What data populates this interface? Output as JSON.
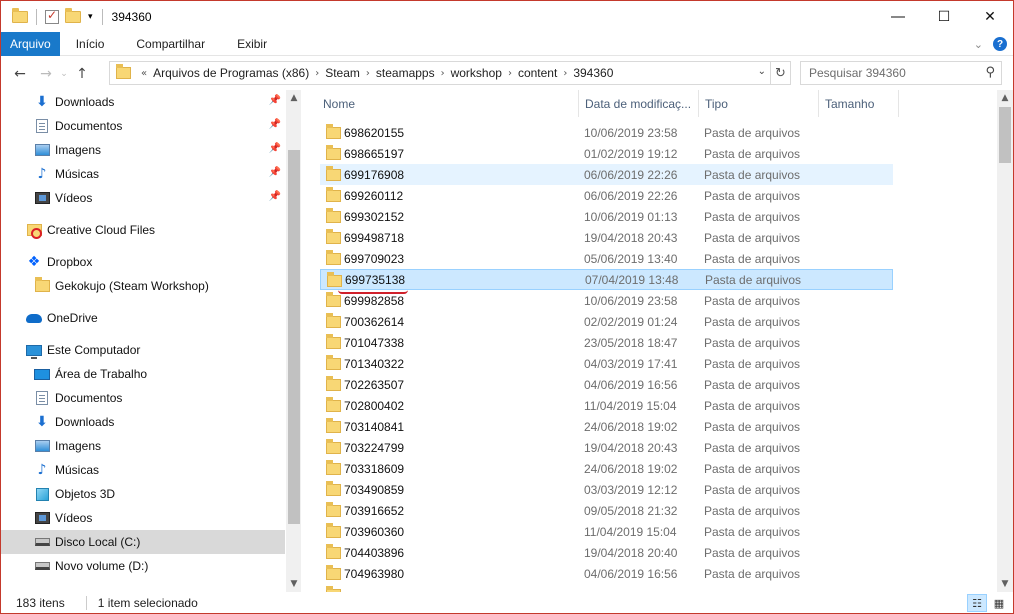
{
  "window": {
    "title": "394360"
  },
  "ribbon": {
    "tabs": [
      "Arquivo",
      "Início",
      "Compartilhar",
      "Exibir"
    ]
  },
  "nav_buttons": {
    "back": "←",
    "forward": "→",
    "recent": "⌄",
    "up": "↑",
    "refresh": "↻"
  },
  "address": {
    "lead": "«",
    "crumbs": [
      "Arquivos de Programas (x86)",
      "Steam",
      "steamapps",
      "workshop",
      "content",
      "394360"
    ]
  },
  "search": {
    "placeholder": "Pesquisar 394360"
  },
  "navpane": {
    "items": [
      {
        "label": "Downloads",
        "icon": "download-icon",
        "pinned": true
      },
      {
        "label": "Documentos",
        "icon": "document-icon",
        "pinned": true
      },
      {
        "label": "Imagens",
        "icon": "image-icon",
        "pinned": true
      },
      {
        "label": "Músicas",
        "icon": "music-icon",
        "pinned": true
      },
      {
        "label": "Vídeos",
        "icon": "video-icon",
        "pinned": true
      },
      {
        "label": "Creative Cloud Files",
        "icon": "creative-cloud-icon",
        "pinned": false
      },
      {
        "label": "Dropbox",
        "icon": "dropbox-icon",
        "pinned": false
      },
      {
        "label": "Gekokujo (Steam Workshop)",
        "icon": "folder-icon",
        "pinned": false
      },
      {
        "label": "OneDrive",
        "icon": "onedrive-icon",
        "pinned": false
      },
      {
        "label": "Este Computador",
        "icon": "computer-icon",
        "pinned": false
      },
      {
        "label": "Área de Trabalho",
        "icon": "desktop-icon",
        "pinned": false
      },
      {
        "label": "Documentos",
        "icon": "document-icon",
        "pinned": false
      },
      {
        "label": "Downloads",
        "icon": "download-icon",
        "pinned": false
      },
      {
        "label": "Imagens",
        "icon": "image-icon",
        "pinned": false
      },
      {
        "label": "Músicas",
        "icon": "music-icon",
        "pinned": false
      },
      {
        "label": "Objetos 3D",
        "icon": "3d-objects-icon",
        "pinned": false
      },
      {
        "label": "Vídeos",
        "icon": "video-icon",
        "pinned": false
      },
      {
        "label": "Disco Local (C:)",
        "icon": "disk-icon",
        "pinned": false,
        "highlighted": true
      },
      {
        "label": "Novo volume (D:)",
        "icon": "disk-icon",
        "pinned": false
      }
    ]
  },
  "columns": [
    "Nome",
    "Data de modificaç...",
    "Tipo",
    "Tamanho"
  ],
  "files": [
    {
      "name": "698620155",
      "date": "10/06/2019 23:58",
      "type": "Pasta de arquivos"
    },
    {
      "name": "698665197",
      "date": "01/02/2019 19:12",
      "type": "Pasta de arquivos"
    },
    {
      "name": "699176908",
      "date": "06/06/2019 22:26",
      "type": "Pasta de arquivos",
      "state": "hover"
    },
    {
      "name": "699260112",
      "date": "06/06/2019 22:26",
      "type": "Pasta de arquivos"
    },
    {
      "name": "699302152",
      "date": "10/06/2019 01:13",
      "type": "Pasta de arquivos"
    },
    {
      "name": "699498718",
      "date": "19/04/2018 20:43",
      "type": "Pasta de arquivos"
    },
    {
      "name": "699709023",
      "date": "05/06/2019 13:40",
      "type": "Pasta de arquivos"
    },
    {
      "name": "699735138",
      "date": "07/04/2019 13:48",
      "type": "Pasta de arquivos",
      "state": "selected"
    },
    {
      "name": "699982858",
      "date": "10/06/2019 23:58",
      "type": "Pasta de arquivos"
    },
    {
      "name": "700362614",
      "date": "02/02/2019 01:24",
      "type": "Pasta de arquivos"
    },
    {
      "name": "701047338",
      "date": "23/05/2018 18:47",
      "type": "Pasta de arquivos"
    },
    {
      "name": "701340322",
      "date": "04/03/2019 17:41",
      "type": "Pasta de arquivos"
    },
    {
      "name": "702263507",
      "date": "04/06/2019 16:56",
      "type": "Pasta de arquivos"
    },
    {
      "name": "702800402",
      "date": "11/04/2019 15:04",
      "type": "Pasta de arquivos"
    },
    {
      "name": "703140841",
      "date": "24/06/2018 19:02",
      "type": "Pasta de arquivos"
    },
    {
      "name": "703224799",
      "date": "19/04/2018 20:43",
      "type": "Pasta de arquivos"
    },
    {
      "name": "703318609",
      "date": "24/06/2018 19:02",
      "type": "Pasta de arquivos"
    },
    {
      "name": "703490859",
      "date": "03/03/2019 12:12",
      "type": "Pasta de arquivos"
    },
    {
      "name": "703916652",
      "date": "09/05/2018 21:32",
      "type": "Pasta de arquivos"
    },
    {
      "name": "703960360",
      "date": "11/04/2019 15:04",
      "type": "Pasta de arquivos"
    },
    {
      "name": "704403896",
      "date": "19/04/2018 20:40",
      "type": "Pasta de arquivos"
    },
    {
      "name": "704963980",
      "date": "04/06/2019 16:56",
      "type": "Pasta de arquivos"
    }
  ],
  "status": {
    "count": "183 itens",
    "selection": "1 item selecionado"
  },
  "colors": {
    "accent": "#1979ca",
    "selection": "#cce8ff",
    "hover": "#e5f3ff",
    "annotation": "#d0202a"
  }
}
